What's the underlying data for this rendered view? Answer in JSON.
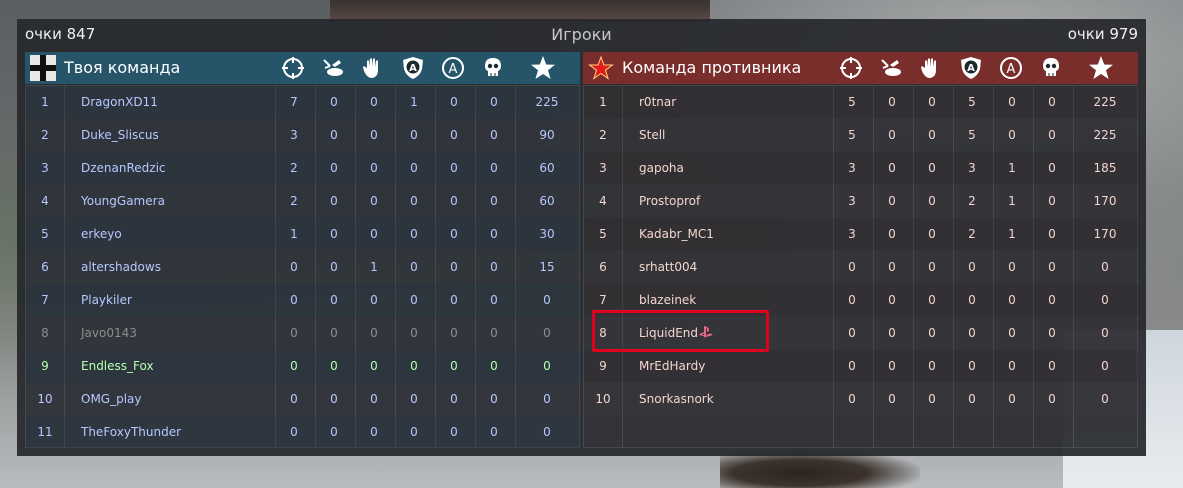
{
  "header": {
    "score_left": "очки 847",
    "title": "Игроки",
    "score_right": "очки 979"
  },
  "colors": {
    "ally_header": "#26556a",
    "enemy_header": "#7a2e2c",
    "highlight": "#e0001e"
  },
  "stat_icons": [
    "crosshair-icon",
    "bomb-icon",
    "hand-icon",
    "shield-a-icon",
    "circle-a-icon",
    "skull-icon",
    "star-icon"
  ],
  "teams": {
    "ally": {
      "name": "Твоя команда",
      "emblem": "iron-cross-icon",
      "players": [
        {
          "rank": "1",
          "name": "DragonXD11",
          "stats": [
            "7",
            "0",
            "0",
            "1",
            "0",
            "0"
          ],
          "points": "225"
        },
        {
          "rank": "2",
          "name": "Duke_Sliscus",
          "stats": [
            "3",
            "0",
            "0",
            "0",
            "0",
            "0"
          ],
          "points": "90"
        },
        {
          "rank": "3",
          "name": "DzenanRedzic",
          "stats": [
            "2",
            "0",
            "0",
            "0",
            "0",
            "0"
          ],
          "points": "60"
        },
        {
          "rank": "4",
          "name": "YoungGamera",
          "stats": [
            "2",
            "0",
            "0",
            "0",
            "0",
            "0"
          ],
          "points": "60"
        },
        {
          "rank": "5",
          "name": "erkeyo",
          "stats": [
            "1",
            "0",
            "0",
            "0",
            "0",
            "0"
          ],
          "points": "30"
        },
        {
          "rank": "6",
          "name": "altershadows",
          "stats": [
            "0",
            "0",
            "1",
            "0",
            "0",
            "0"
          ],
          "points": "15"
        },
        {
          "rank": "7",
          "name": "Playkiler",
          "stats": [
            "0",
            "0",
            "0",
            "0",
            "0",
            "0"
          ],
          "points": "0"
        },
        {
          "rank": "8",
          "name": "Javo0143",
          "stats": [
            "0",
            "0",
            "0",
            "0",
            "0",
            "0"
          ],
          "points": "0",
          "style": "dim"
        },
        {
          "rank": "9",
          "name": "Endless_Fox",
          "stats": [
            "0",
            "0",
            "0",
            "0",
            "0",
            "0"
          ],
          "points": "0",
          "style": "green"
        },
        {
          "rank": "10",
          "name": "OMG_play",
          "stats": [
            "0",
            "0",
            "0",
            "0",
            "0",
            "0"
          ],
          "points": "0"
        },
        {
          "rank": "11",
          "name": "TheFoxyThunder",
          "stats": [
            "0",
            "0",
            "0",
            "0",
            "0",
            "0"
          ],
          "points": "0"
        }
      ]
    },
    "enemy": {
      "name": "Команда противника",
      "emblem": "red-star-icon",
      "players": [
        {
          "rank": "1",
          "name": "r0tnar",
          "stats": [
            "5",
            "0",
            "0",
            "5",
            "0",
            "0"
          ],
          "points": "225"
        },
        {
          "rank": "2",
          "name": "Stell",
          "stats": [
            "5",
            "0",
            "0",
            "5",
            "0",
            "0"
          ],
          "points": "225"
        },
        {
          "rank": "3",
          "name": "gapoha",
          "stats": [
            "3",
            "0",
            "0",
            "3",
            "1",
            "0"
          ],
          "points": "185"
        },
        {
          "rank": "4",
          "name": "Prostoprof",
          "stats": [
            "3",
            "0",
            "0",
            "2",
            "1",
            "0"
          ],
          "points": "170"
        },
        {
          "rank": "5",
          "name": "Kadabr_MC1",
          "stats": [
            "3",
            "0",
            "0",
            "2",
            "1",
            "0"
          ],
          "points": "170"
        },
        {
          "rank": "6",
          "name": "srhatt004",
          "stats": [
            "0",
            "0",
            "0",
            "0",
            "0",
            "0"
          ],
          "points": "0"
        },
        {
          "rank": "7",
          "name": "blazeinek",
          "stats": [
            "0",
            "0",
            "0",
            "0",
            "0",
            "0"
          ],
          "points": "0"
        },
        {
          "rank": "8",
          "name": "LiquidEnd",
          "stats": [
            "0",
            "0",
            "0",
            "0",
            "0",
            "0"
          ],
          "points": "0",
          "platform": "playstation-icon"
        },
        {
          "rank": "9",
          "name": "MrEdHardy",
          "stats": [
            "0",
            "0",
            "0",
            "0",
            "0",
            "0"
          ],
          "points": "0"
        },
        {
          "rank": "10",
          "name": "Snorkasnork",
          "stats": [
            "0",
            "0",
            "0",
            "0",
            "0",
            "0"
          ],
          "points": "0"
        }
      ]
    }
  }
}
